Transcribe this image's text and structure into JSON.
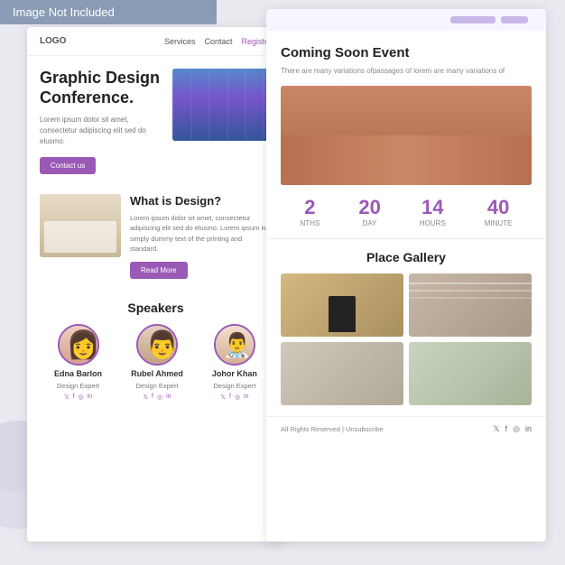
{
  "banner": {
    "text": "Image Not Included"
  },
  "left_card": {
    "nav": {
      "logo": "LOGO",
      "links": [
        "Services",
        "Contact"
      ],
      "register": "Register"
    },
    "hero": {
      "title": "Graphic Design Conference.",
      "description": "Lorem ipsum dolor sit amet, consectetur adipiscing elit  sed do elusmo.",
      "button": "Contact us"
    },
    "design_section": {
      "title": "What is Design?",
      "description": "Lorem ipsum dolor sit amet, consectetur adipiscing elit  sed do elusmo. Lorem ipsum is simply dummy text of the printing and standard.",
      "button": "Read More"
    },
    "speakers": {
      "title": "Speakers",
      "list": [
        {
          "name": "Edna Barlon",
          "role": "Design Expert"
        },
        {
          "name": "Rubel Ahmed",
          "role": "Design Expert"
        },
        {
          "name": "Johor Khan",
          "role": "Design Expert"
        }
      ]
    }
  },
  "right_card": {
    "coming_soon": {
      "title": "Coming Soon Event",
      "description": "There are many variations ofpassages of lorem are many variations of"
    },
    "countdown": [
      {
        "number": "2",
        "label": "NTHS"
      },
      {
        "number": "20",
        "label": "DAY"
      },
      {
        "number": "14",
        "label": "HOURS"
      },
      {
        "number": "40",
        "label": "MINUTE"
      }
    ],
    "gallery": {
      "title": "Place Gallery"
    },
    "footer": {
      "text": "All Rights Reserved | Unsubscribe",
      "social": [
        "𝕏",
        "f",
        "◎",
        "in"
      ]
    }
  }
}
